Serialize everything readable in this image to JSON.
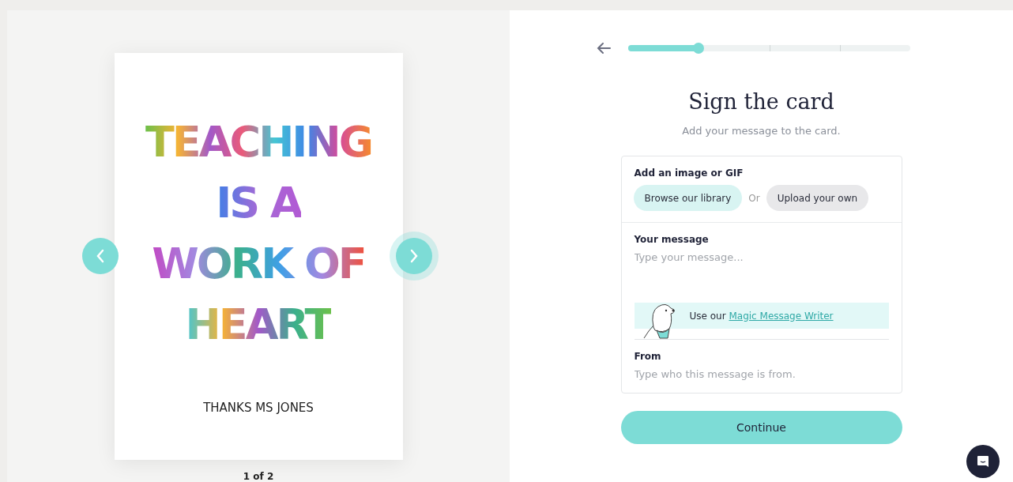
{
  "card_preview": {
    "headline": [
      "TEACHING",
      "IS A",
      "WORK OF",
      "HEART"
    ],
    "signature": "THANKS MS JONES",
    "pager": "1 of 2"
  },
  "progress": {
    "level": 0.25
  },
  "title": "Sign the card",
  "subtitle": "Add your message to the card.",
  "image_section": {
    "label": "Add an image or GIF",
    "buttons": [
      {
        "label": "Browse our library",
        "selected": true
      },
      {
        "label": "Upload your own",
        "selected": false
      }
    ],
    "separator": "Or"
  },
  "message": {
    "label": "Your message",
    "placeholder": "Type your message...",
    "helper_prefix": "Use our",
    "helper_link": "Magic Message Writer"
  },
  "from": {
    "label": "From",
    "placeholder": "Type who this message is from."
  },
  "continue_button": "Continue"
}
